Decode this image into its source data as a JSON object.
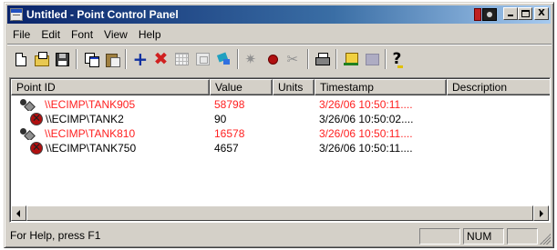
{
  "window": {
    "title": "Untitled - Point Control Panel",
    "title_bar_buttons": [
      "minimize",
      "maximize",
      "close"
    ],
    "close_glyph": "X"
  },
  "menu": [
    {
      "label": "File"
    },
    {
      "label": "Edit"
    },
    {
      "label": "Font"
    },
    {
      "label": "View"
    },
    {
      "label": "Help"
    }
  ],
  "toolbar": {
    "buttons": [
      {
        "icon": "new-document-icon",
        "enabled": true
      },
      {
        "icon": "open-folder-icon",
        "enabled": true
      },
      {
        "icon": "save-disk-icon",
        "enabled": true
      },
      {
        "icon": "copy-icon",
        "enabled": true
      },
      {
        "icon": "paste-icon",
        "enabled": true
      },
      {
        "icon": "add-point-icon",
        "enabled": true,
        "glyph": "+"
      },
      {
        "icon": "delete-point-icon",
        "enabled": true,
        "glyph": "✖"
      },
      {
        "icon": "grid-icon",
        "enabled": false
      },
      {
        "icon": "properties-icon",
        "enabled": false
      },
      {
        "icon": "tag-icon",
        "enabled": true
      },
      {
        "icon": "gray-star-icon",
        "enabled": false,
        "glyph": "✷"
      },
      {
        "icon": "record-dot-icon",
        "enabled": true
      },
      {
        "icon": "tools-icon",
        "enabled": false,
        "glyph": "✂"
      },
      {
        "icon": "print-icon",
        "enabled": true
      },
      {
        "icon": "chart-icon",
        "enabled": true
      },
      {
        "icon": "chart-disabled-icon",
        "enabled": false
      },
      {
        "icon": "help-icon",
        "enabled": true,
        "glyph": "?"
      }
    ]
  },
  "list": {
    "columns": [
      "Point ID",
      "Value",
      "Units",
      "Timestamp",
      "Description"
    ],
    "rows": [
      {
        "indent": 0,
        "icon": "point-ok-icon",
        "point_id": "\\\\ECIMP\\TANK905",
        "value": "58798",
        "units": "",
        "timestamp": "3/26/06  10:50:11....",
        "description": "",
        "alarm": true
      },
      {
        "indent": 1,
        "icon": "point-alarm-icon",
        "point_id": "\\\\ECIMP\\TANK2",
        "value": "90",
        "units": "",
        "timestamp": "3/26/06  10:50:02....",
        "description": "",
        "alarm": false
      },
      {
        "indent": 0,
        "icon": "point-ok-icon",
        "point_id": "\\\\ECIMP\\TANK810",
        "value": "16578",
        "units": "",
        "timestamp": "3/26/06  10:50:11....",
        "description": "",
        "alarm": true
      },
      {
        "indent": 1,
        "icon": "point-alarm-icon",
        "point_id": "\\\\ECIMP\\TANK750",
        "value": "4657",
        "units": "",
        "timestamp": "3/26/06  10:50:11....",
        "description": "",
        "alarm": false
      }
    ]
  },
  "status": {
    "help_text": "For Help, press F1",
    "panels": [
      "",
      "NUM",
      ""
    ]
  },
  "colors": {
    "alarm_text": "#ff2020",
    "title_bar": "#0a246a",
    "face": "#d4d0c8"
  }
}
